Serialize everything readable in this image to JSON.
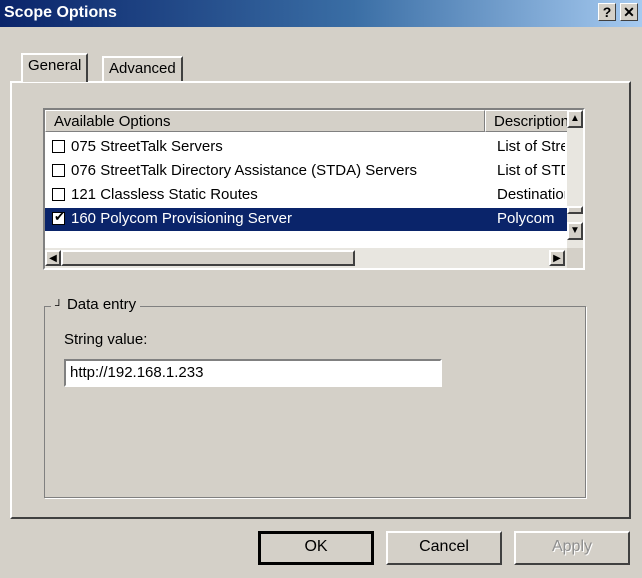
{
  "window": {
    "title": "Scope Options",
    "help_label": "?",
    "close_label": "✕"
  },
  "tabs": [
    {
      "label": "General",
      "active": true
    },
    {
      "label": "Advanced",
      "active": false
    }
  ],
  "options_list": {
    "columns": [
      "Available Options",
      "Description"
    ],
    "rows": [
      {
        "checked": false,
        "name": "075 StreetTalk Servers",
        "description": "List of Street"
      },
      {
        "checked": false,
        "name": "076 StreetTalk Directory Assistance (STDA) Servers",
        "description": "List of STDA"
      },
      {
        "checked": false,
        "name": "121 Classless Static Routes",
        "description": "Destination,"
      },
      {
        "checked": true,
        "name": "160 Polycom Provisioning Server",
        "description": "Polycom",
        "selected": true
      }
    ]
  },
  "data_entry": {
    "group_label": "Data entry",
    "field_label": "String value:",
    "field_value": "http://192.168.1.233"
  },
  "buttons": {
    "ok": "OK",
    "cancel": "Cancel",
    "apply": "Apply"
  },
  "icons": [
    "help-icon",
    "close-icon",
    "scroll-up-icon",
    "scroll-down-icon",
    "scroll-left-icon",
    "scroll-right-icon",
    "checkmark-icon",
    "collapse-glyph-icon"
  ],
  "colors": {
    "selection": "#0a246a",
    "titlebar_start": "#0a246a",
    "titlebar_end": "#a6caf0"
  }
}
